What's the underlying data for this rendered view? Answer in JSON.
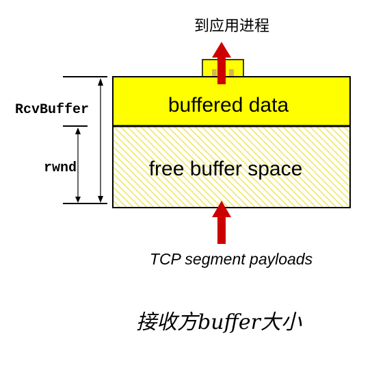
{
  "labels": {
    "to_app_process": "到应用进程",
    "rcv_buffer": "RcvBuffer",
    "rwnd": "rwnd",
    "buffered_data": "buffered data",
    "free_buffer_space": "free buffer space",
    "tcp_segment_payloads": "TCP segment payloads",
    "caption": "接收方buffer大小"
  },
  "colors": {
    "buffer_fill": "#ffff00",
    "hatch_line": "#f0e878",
    "arrow": "#cc0000",
    "line": "#000000"
  }
}
